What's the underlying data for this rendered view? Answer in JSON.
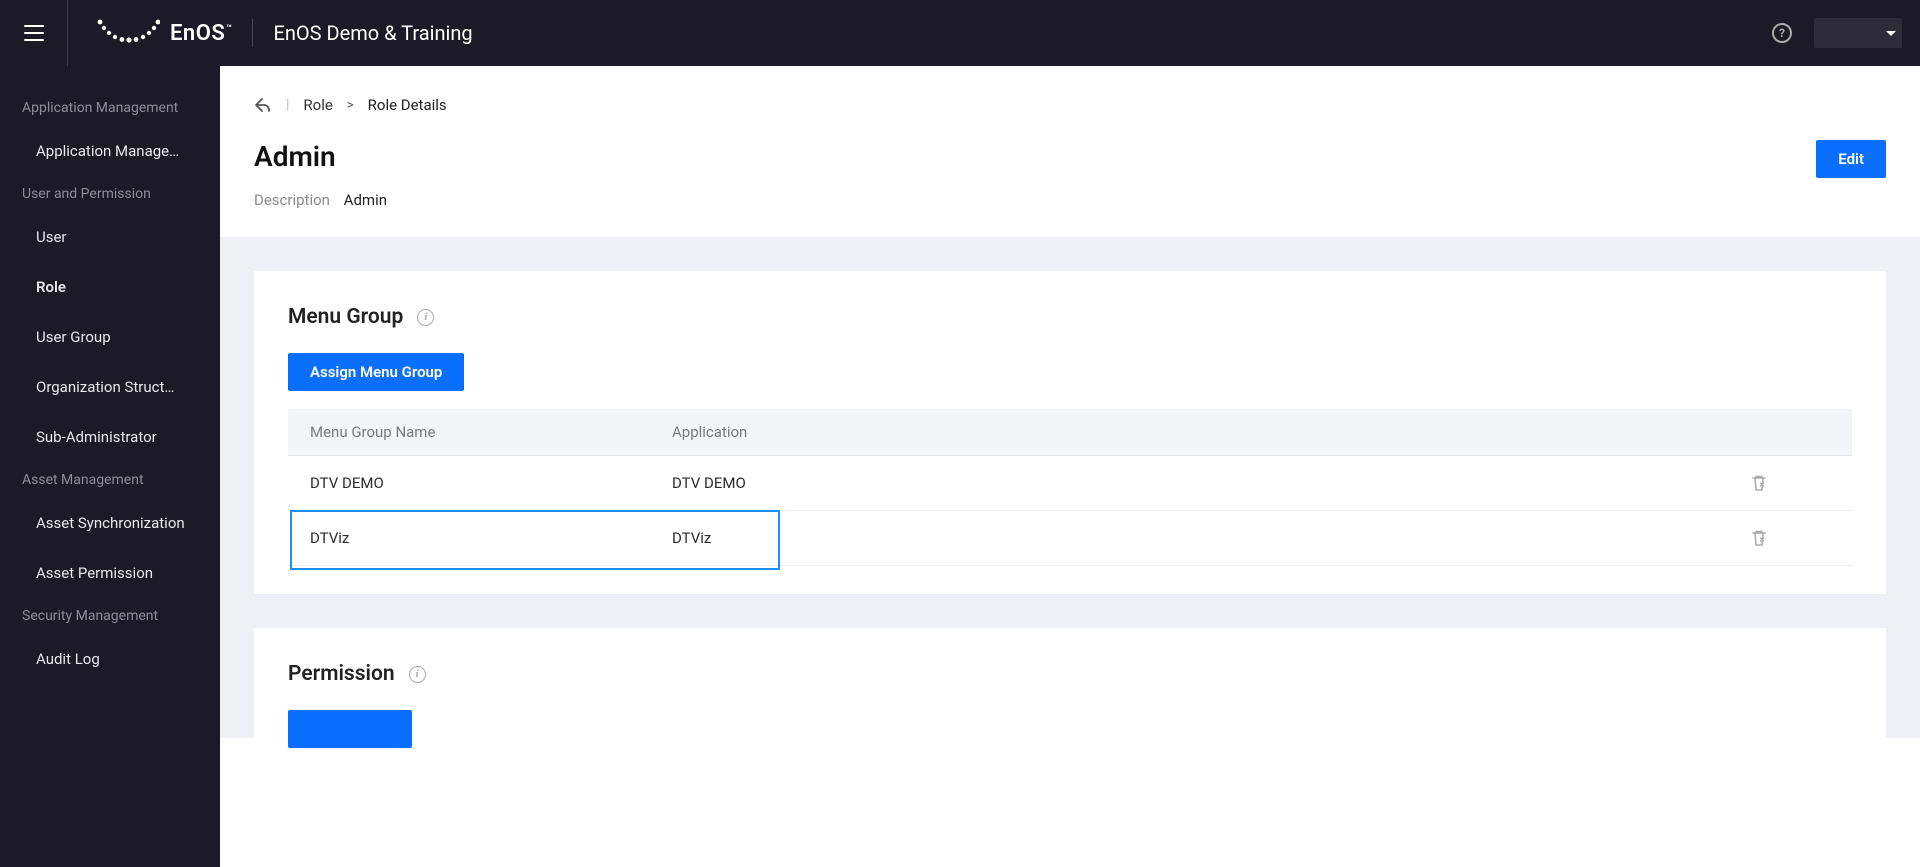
{
  "header": {
    "brand_text": "EnOS",
    "product_title": "EnOS Demo & Training"
  },
  "sidebar": {
    "sections": [
      {
        "label": "Application Management",
        "items": [
          {
            "label": "Application Manage…"
          }
        ]
      },
      {
        "label": "User and Permission",
        "items": [
          {
            "label": "User"
          },
          {
            "label": "Role"
          },
          {
            "label": "User Group"
          },
          {
            "label": "Organization Struct…"
          },
          {
            "label": "Sub-Administrator"
          }
        ]
      },
      {
        "label": "Asset Management",
        "items": [
          {
            "label": "Asset Synchronization"
          },
          {
            "label": "Asset Permission"
          }
        ]
      },
      {
        "label": "Security Management",
        "items": [
          {
            "label": "Audit Log"
          }
        ]
      }
    ]
  },
  "breadcrumb": {
    "parent": "Role",
    "current": "Role Details"
  },
  "page": {
    "title": "Admin",
    "desc_label": "Description",
    "desc_value": "Admin",
    "edit_label": "Edit"
  },
  "menu_group": {
    "title": "Menu Group",
    "assign_label": "Assign Menu Group",
    "columns": {
      "name": "Menu Group Name",
      "application": "Application"
    },
    "rows": [
      {
        "name": "DTV DEMO",
        "application": "DTV DEMO"
      },
      {
        "name": "DTViz",
        "application": "DTViz"
      }
    ]
  },
  "permission": {
    "title": "Permission"
  }
}
